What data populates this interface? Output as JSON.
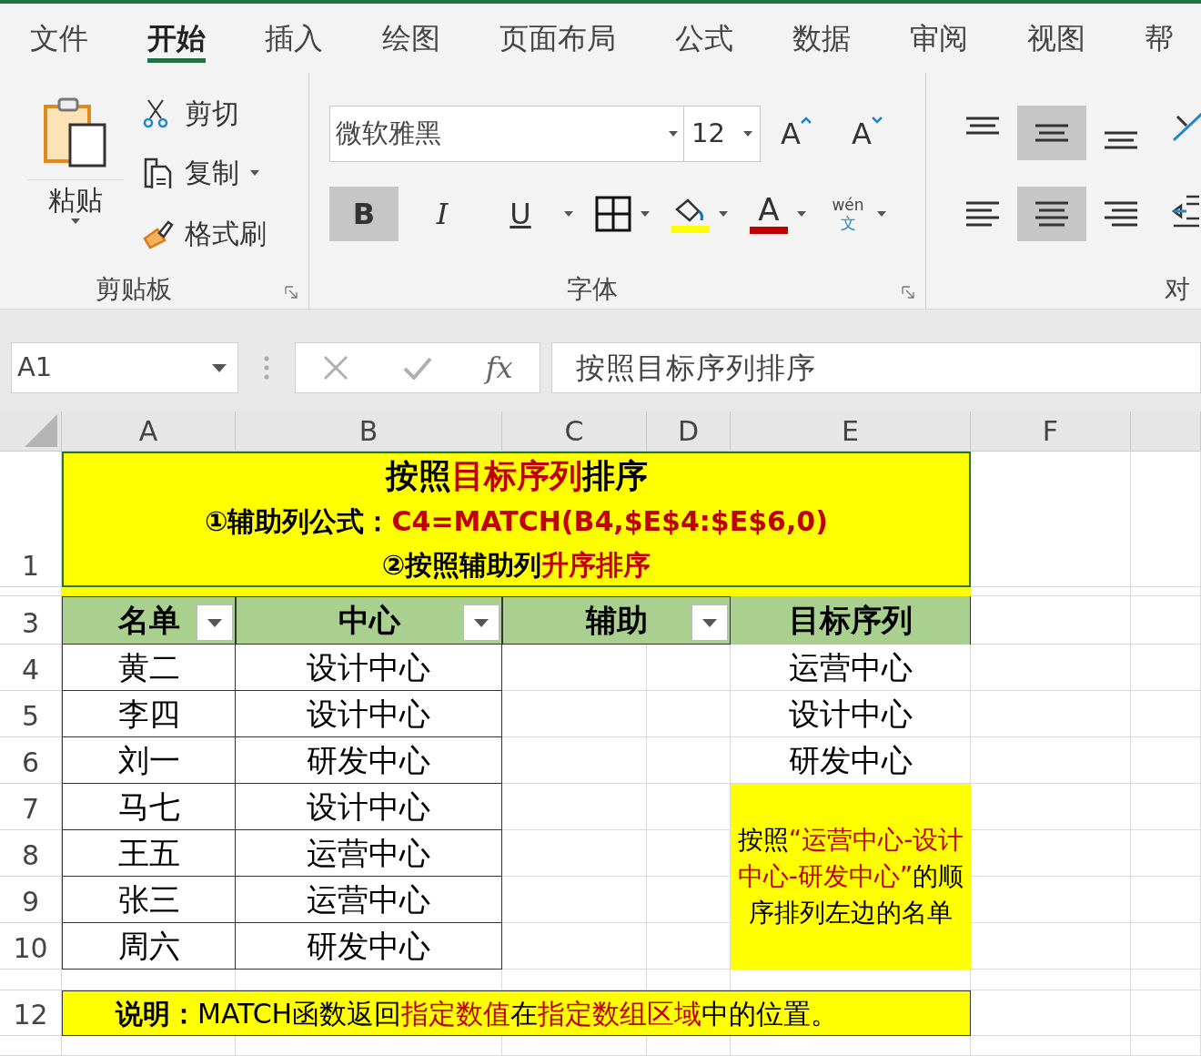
{
  "tabs": [
    {
      "label": "文件",
      "selected": false
    },
    {
      "label": "开始",
      "selected": true
    },
    {
      "label": "插入",
      "selected": false
    },
    {
      "label": "绘图",
      "selected": false
    },
    {
      "label": "页面布局",
      "selected": false
    },
    {
      "label": "公式",
      "selected": false
    },
    {
      "label": "数据",
      "selected": false
    },
    {
      "label": "审阅",
      "selected": false
    },
    {
      "label": "视图",
      "selected": false
    },
    {
      "label": "帮",
      "selected": false
    }
  ],
  "clipboard": {
    "paste": "粘贴",
    "cut": "剪切",
    "copy": "复制",
    "format_painter": "格式刷",
    "label": "剪贴板"
  },
  "font": {
    "name": "微软雅黑",
    "size": "12",
    "grow": "A",
    "shrink": "A",
    "bold": {
      "label": "B",
      "selected": true
    },
    "italic": {
      "label": "I",
      "selected": false
    },
    "underline": {
      "label": "U",
      "selected": false
    },
    "font_color_letter": "A",
    "phonetic_top": "wén",
    "phonetic_bottom": "文",
    "label": "字体"
  },
  "alignment": {
    "vertical": [
      {
        "selected": false
      },
      {
        "selected": true
      },
      {
        "selected": false
      }
    ],
    "horizontal": [
      {
        "selected": false
      },
      {
        "selected": true
      },
      {
        "selected": false
      }
    ],
    "label": "对"
  },
  "formula_bar": {
    "name_box": "A1",
    "function_label": "fx",
    "formula": "按照目标序列排序"
  },
  "sheet": {
    "columns": [
      "A",
      "B",
      "C",
      "D",
      "E",
      "F"
    ],
    "row_labels": [
      "1",
      "3",
      "4",
      "5",
      "6",
      "7",
      "8",
      "9",
      "10",
      "12"
    ],
    "title": [
      [
        {
          "text": "按照",
          "highlight": false
        },
        {
          "text": "目标序列",
          "highlight": true
        },
        {
          "text": "排序",
          "highlight": false
        }
      ],
      [
        {
          "text": "①辅助列公式：",
          "highlight": false
        },
        {
          "text": "C4=MATCH(B4,$E$4:$E$6,0)",
          "highlight": true
        }
      ],
      [
        {
          "text": "②按照辅助列",
          "highlight": false
        },
        {
          "text": "升序排序",
          "highlight": true
        }
      ]
    ],
    "headers": [
      {
        "text": "名单",
        "filter": true
      },
      {
        "text": "中心",
        "filter": true
      },
      {
        "text": "辅助",
        "filter": true
      },
      {
        "text": "目标序列",
        "filter": false
      }
    ],
    "rows": [
      {
        "name": "黄二",
        "center": "设计中心",
        "target": "运营中心"
      },
      {
        "name": "李四",
        "center": "设计中心",
        "target": "设计中心"
      },
      {
        "name": "刘一",
        "center": "研发中心",
        "target": "研发中心"
      },
      {
        "name": "马七",
        "center": "设计中心"
      },
      {
        "name": "王五",
        "center": "运营中心"
      },
      {
        "name": "张三",
        "center": "运营中心"
      },
      {
        "name": "周六",
        "center": "研发中心"
      }
    ],
    "note": [
      {
        "text": "按照",
        "highlight": false
      },
      {
        "text": "“运营中心-设计中心-研发中心”",
        "highlight": true
      },
      {
        "text": "的顺序排列左边的名单",
        "highlight": false
      }
    ],
    "footer": [
      {
        "text": "**说明：**MATCH函数返回",
        "highlight": false
      },
      {
        "text": "指定数值",
        "highlight": true
      },
      {
        "text": "在",
        "highlight": false
      },
      {
        "text": "指定数组区域",
        "highlight": true
      },
      {
        "text": "中的位置。",
        "highlight": false
      }
    ]
  }
}
